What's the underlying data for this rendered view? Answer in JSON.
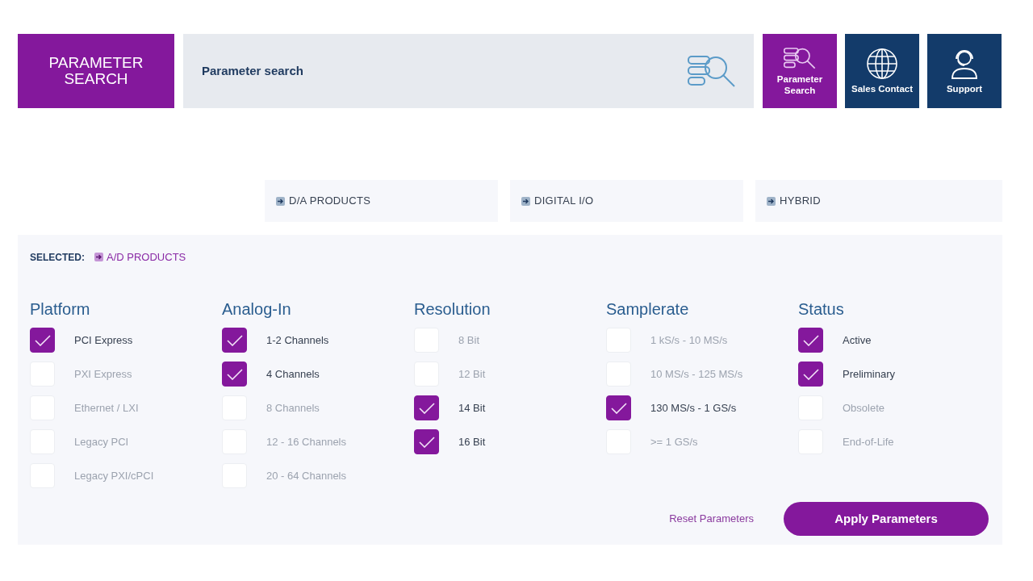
{
  "logo": {
    "text": "PARAMETER SEARCH"
  },
  "search_banner": {
    "title": "Parameter search"
  },
  "nav_tiles": [
    {
      "label": "Parameter Search",
      "kind": "param",
      "selected": true
    },
    {
      "label": "Sales Contact",
      "kind": "globe",
      "selected": false
    },
    {
      "label": "Support",
      "kind": "support",
      "selected": false
    }
  ],
  "categories": [
    "D/A PRODUCTS",
    "DIGITAL I/O",
    "HYBRID"
  ],
  "selected": {
    "label": "SELECTED:",
    "value": "A/D PRODUCTS"
  },
  "filters": [
    {
      "title": "Platform",
      "options": [
        {
          "label": "PCI Express",
          "checked": true
        },
        {
          "label": "PXI Express",
          "checked": false
        },
        {
          "label": "Ethernet / LXI",
          "checked": false
        },
        {
          "label": "Legacy PCI",
          "checked": false
        },
        {
          "label": "Legacy PXI/cPCI",
          "checked": false
        }
      ]
    },
    {
      "title": "Analog-In",
      "options": [
        {
          "label": "1-2 Channels",
          "checked": true
        },
        {
          "label": "4 Channels",
          "checked": true
        },
        {
          "label": "8 Channels",
          "checked": false
        },
        {
          "label": "12 - 16 Channels",
          "checked": false
        },
        {
          "label": "20 - 64 Channels",
          "checked": false
        }
      ]
    },
    {
      "title": "Resolution",
      "options": [
        {
          "label": "8 Bit",
          "checked": false
        },
        {
          "label": "12 Bit",
          "checked": false
        },
        {
          "label": "14 Bit",
          "checked": true
        },
        {
          "label": "16 Bit",
          "checked": true
        }
      ]
    },
    {
      "title": "Samplerate",
      "options": [
        {
          "label": "1 kS/s - 10 MS/s",
          "checked": false
        },
        {
          "label": "10 MS/s - 125 MS/s",
          "checked": false
        },
        {
          "label": "130 MS/s - 1 GS/s",
          "checked": true
        },
        {
          "label": ">= 1 GS/s",
          "checked": false
        }
      ]
    },
    {
      "title": "Status",
      "options": [
        {
          "label": "Active",
          "checked": true
        },
        {
          "label": "Preliminary",
          "checked": true
        },
        {
          "label": "Obsolete",
          "checked": false
        },
        {
          "label": "End-of-Life",
          "checked": false
        }
      ]
    }
  ],
  "actions": {
    "reset": "Reset Parameters",
    "apply": "Apply Parameters"
  }
}
